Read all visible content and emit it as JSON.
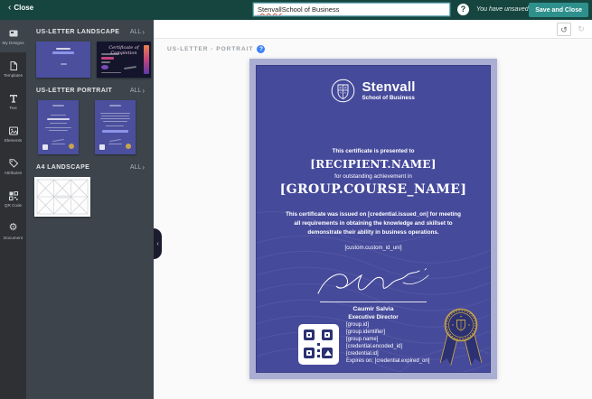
{
  "icons": {
    "back_chevron": "‹",
    "forward_chevron": "›",
    "undo": "↺",
    "redo": "↻",
    "help": "?",
    "info": "?",
    "collapse": "‹",
    "gear": "⚙"
  },
  "colors": {
    "topbar_teal": "#16453F",
    "save_button_teal": "#2E908C",
    "sidebar_dark": "#2E3034",
    "panel_slate": "#3D444C",
    "certificate_body": "#464A9B",
    "certificate_border": "#A9AED2",
    "seal_gold": "#C8A54B",
    "ribbon_navy": "#2B3172",
    "info_blue": "#3B82F6",
    "misspell_red": "#CF4A3C"
  },
  "topbar": {
    "close_label": "Close",
    "design_title": {
      "misspelled_word": "Stenvall",
      "rest": " School of Business"
    },
    "unsaved_text": "You have unsaved changes",
    "save_label": "Save and Close"
  },
  "sidebar": {
    "items": [
      {
        "label": "My Designs",
        "active": true
      },
      {
        "label": "Templates",
        "active": false
      },
      {
        "label": "Text",
        "active": false
      },
      {
        "label": "Elements",
        "active": false
      },
      {
        "label": "Attributes",
        "active": false
      },
      {
        "label": "QR Code",
        "active": false
      },
      {
        "label": "Document",
        "active": false
      }
    ]
  },
  "panel": {
    "sections": [
      {
        "title": "US-LETTER LANDSCAPE",
        "all_label": "ALL"
      },
      {
        "title": "US-LETTER PORTRAIT",
        "all_label": "ALL"
      },
      {
        "title": "A4 LANDSCAPE",
        "all_label": "ALL"
      }
    ]
  },
  "canvas": {
    "size_label": "US-LETTER - PORTRAIT"
  },
  "certificate": {
    "brand_name": "Stenvall",
    "brand_sub": "School of Business",
    "presented_line": "This certificate is presented to",
    "recipient_placeholder": "[RECIPIENT.NAME]",
    "achievement_line": "for outstanding achievement in",
    "course_placeholder": "[GROUP.COURSE_NAME]",
    "body_text": "This certificate was issued on [credential.issued_on] for meeting all requirements in obtaining the knowledge and skillset to demonstrate their ability in business operations.",
    "custom_id": "[custom.custom_id_uni]",
    "signer_name": "Caumir Salvia",
    "signer_title": "Executive Director",
    "meta_lines": [
      "[group.id]",
      "[group.identifier]",
      "[group.name]",
      "[credential.encoded_id]",
      "[credential.id]",
      "Expires on: [credential.expired_on]"
    ]
  }
}
